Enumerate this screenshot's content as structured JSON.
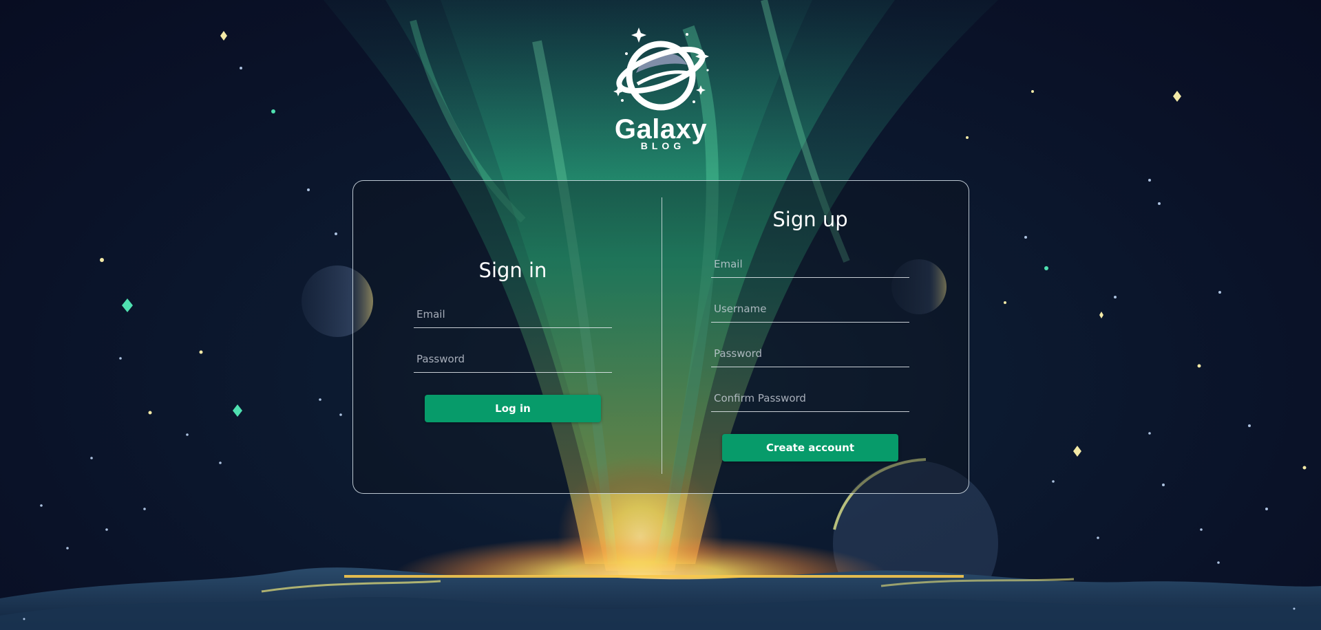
{
  "brand": {
    "name": "Galaxy",
    "subtitle": "BLOG"
  },
  "sign_in": {
    "title": "Sign in",
    "email_placeholder": "Email",
    "password_placeholder": "Password",
    "submit_label": "Log in"
  },
  "sign_up": {
    "title": "Sign up",
    "email_placeholder": "Email",
    "username_placeholder": "Username",
    "password_placeholder": "Password",
    "confirm_password_placeholder": "Confirm Password",
    "submit_label": "Create account"
  },
  "colors": {
    "accent": "#079b6a",
    "background": "#0a1228",
    "aurora_green": "#2fd18f",
    "aurora_orange": "#f08a3c",
    "glow_yellow": "#f7d55a"
  },
  "icons": {
    "logo": "planet-with-ring-and-stars"
  }
}
